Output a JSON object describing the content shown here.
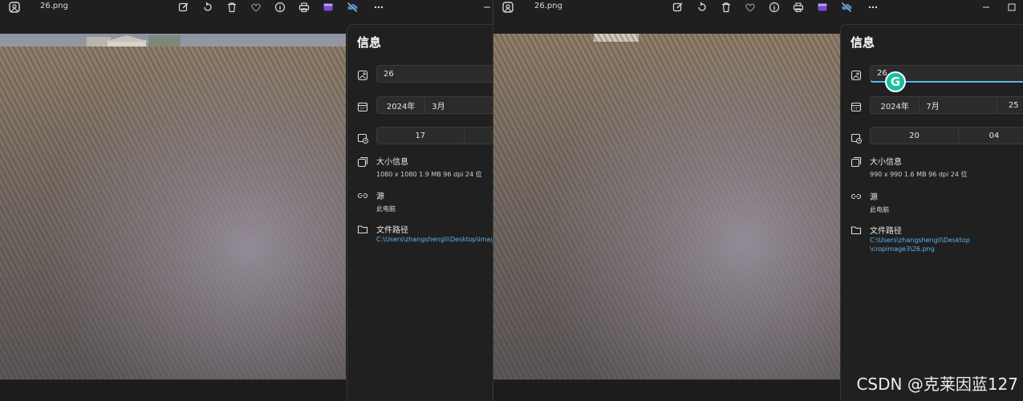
{
  "watermark": "CSDN @克莱因蓝127",
  "windows": [
    {
      "file_name": "26.png",
      "panel": {
        "title": "信息",
        "name_value": "26",
        "date": {
          "year": "2024年",
          "month": "3月"
        },
        "time": {
          "hour": "17"
        },
        "size_title": "大小信息",
        "size_details": "1080 x 1080    1.9 MB    96 dpi    24 位",
        "source_title": "源",
        "source_value": "此电脑",
        "path_title": "文件路径",
        "path_value": "C:\\Users\\zhangshengli\\Desktop\\imag"
      }
    },
    {
      "file_name": "26.png",
      "panel": {
        "title": "信息",
        "name_value": "26",
        "date": {
          "year": "2024年",
          "month": "7月",
          "day": "25"
        },
        "time": {
          "hour": "20",
          "minute": "04"
        },
        "size_title": "大小信息",
        "size_details": "990 x 990    1.6 MB    96 dpi    24 位",
        "source_title": "源",
        "source_value": "此电脑",
        "path_title": "文件路径",
        "path_line1": "C:\\Users\\zhangshengli\\Desktop",
        "path_line2": "\\cropimage3\\26.png"
      }
    }
  ],
  "icons": {
    "app": "photos-app-icon",
    "toolbar": [
      "edit-icon",
      "rotate-icon",
      "delete-icon",
      "favorite-heart-icon",
      "info-icon",
      "print-icon",
      "clipchamp-icon",
      "onedrive-offline-icon",
      "more-icon"
    ],
    "rows": [
      "image-icon",
      "calendar-icon",
      "clock-icon",
      "size-icon",
      "link-icon",
      "folder-icon"
    ]
  },
  "colors": {
    "accent": "#5fb4f0",
    "panel_bg": "#202020",
    "grammarly": "#15c39a"
  }
}
